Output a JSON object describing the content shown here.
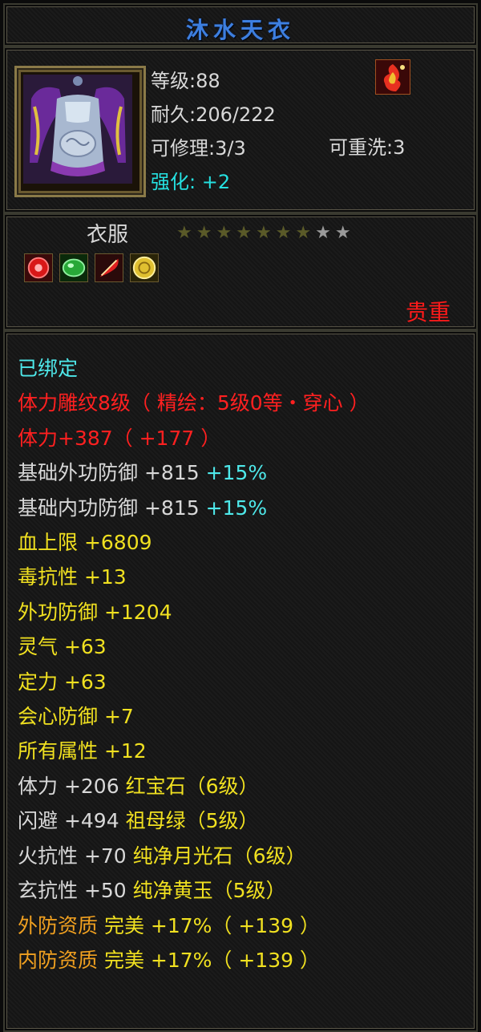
{
  "item": {
    "name": "沐水天衣",
    "level_text": "等级:88",
    "durability_text": "耐久:206/222",
    "repair_text": "可修理:3/3",
    "rewash_text": "可重洗:3",
    "enhance_label": "强化:",
    "enhance_value": "+2",
    "type": "衣服",
    "rarity": "贵重",
    "stars_total": 9,
    "stars_filled": 7,
    "gem_icons": [
      "red-gem-icon",
      "green-jade-icon",
      "red-feather-icon",
      "gold-coin-icon"
    ]
  },
  "attributes": [
    {
      "segments": [
        {
          "text": "已绑定",
          "color": "cyan"
        }
      ]
    },
    {
      "segments": [
        {
          "text": "体力雕纹8级（ 精绘：5级0等・穿心 ）",
          "color": "red"
        }
      ]
    },
    {
      "segments": [
        {
          "text": "体力+387（ +177 ）",
          "color": "red"
        }
      ]
    },
    {
      "segments": [
        {
          "text": "基础外功防御  +815 ",
          "color": "white"
        },
        {
          "text": "+15%",
          "color": "cyan"
        }
      ]
    },
    {
      "segments": [
        {
          "text": "基础内功防御  +815 ",
          "color": "white"
        },
        {
          "text": "+15%",
          "color": "cyan"
        }
      ]
    },
    {
      "segments": [
        {
          "text": "血上限  +6809",
          "color": "yellow"
        }
      ]
    },
    {
      "segments": [
        {
          "text": "毒抗性  +13",
          "color": "yellow"
        }
      ]
    },
    {
      "segments": [
        {
          "text": "外功防御  +1204",
          "color": "yellow"
        }
      ]
    },
    {
      "segments": [
        {
          "text": "灵气  +63",
          "color": "yellow"
        }
      ]
    },
    {
      "segments": [
        {
          "text": "定力  +63",
          "color": "yellow"
        }
      ]
    },
    {
      "segments": [
        {
          "text": "会心防御  +7",
          "color": "yellow"
        }
      ]
    },
    {
      "segments": [
        {
          "text": "所有属性  +12",
          "color": "yellow"
        }
      ]
    },
    {
      "segments": [
        {
          "text": "体力  +206  ",
          "color": "white"
        },
        {
          "text": "红宝石（6级）",
          "color": "yellow"
        }
      ]
    },
    {
      "segments": [
        {
          "text": "闪避  +494  ",
          "color": "white"
        },
        {
          "text": "祖母绿（5级）",
          "color": "yellow"
        }
      ]
    },
    {
      "segments": [
        {
          "text": "火抗性  +70  ",
          "color": "white"
        },
        {
          "text": "纯净月光石（6级）",
          "color": "yellow"
        }
      ]
    },
    {
      "segments": [
        {
          "text": "玄抗性  +50  ",
          "color": "white"
        },
        {
          "text": "纯净黄玉（5级）",
          "color": "yellow"
        }
      ]
    },
    {
      "segments": [
        {
          "text": "外防资质  ",
          "color": "orange"
        },
        {
          "text": "完美  +17%（ +139 ）",
          "color": "yellow"
        }
      ]
    },
    {
      "segments": [
        {
          "text": "内防资质  ",
          "color": "orange"
        },
        {
          "text": "完美  +17%（ +139 ）",
          "color": "yellow"
        }
      ]
    }
  ],
  "colors": {
    "white": "#d8d8d8",
    "cyan": "#4ee8ea",
    "red": "#ff2020",
    "yellow": "#f0e020",
    "orange": "#f0a020",
    "title_blue": "#3d7fe0",
    "star_filled": "#5a5a28",
    "star_empty": "#9a9a9a"
  }
}
